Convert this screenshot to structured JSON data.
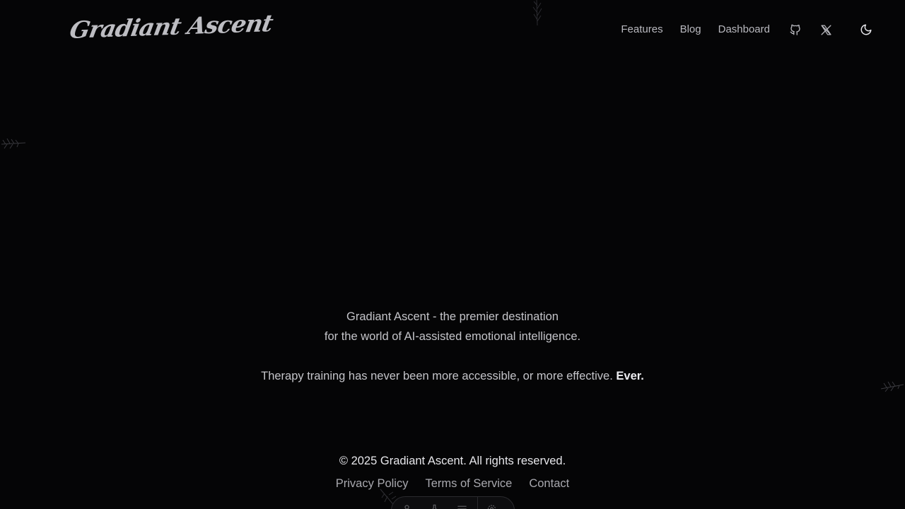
{
  "header": {
    "logo_text": "Gradiant Ascent",
    "nav": [
      {
        "label": "Features"
      },
      {
        "label": "Blog"
      },
      {
        "label": "Dashboard"
      }
    ],
    "icons": [
      "github-icon",
      "x-twitter-icon",
      "moon-icon"
    ]
  },
  "hero": {
    "line1": "Gradiant Ascent - the premier destination",
    "line2": "for the world of AI-assisted emotional intelligence.",
    "line3": "Therapy training has never been more accessible, or more effective.",
    "line3_emphasis": "Ever."
  },
  "footer": {
    "copyright": "© 2025 Gradiant Ascent. All rights reserved.",
    "links": [
      {
        "label": "Privacy Policy"
      },
      {
        "label": "Terms of Service"
      },
      {
        "label": "Contact"
      }
    ]
  },
  "dock": {
    "icons": [
      "person-icon",
      "flask-icon",
      "menu-icon",
      "settings-icon"
    ]
  },
  "colors": {
    "background": "#050506",
    "text": "#c4c4c9",
    "emphasis": "#ececf0"
  }
}
